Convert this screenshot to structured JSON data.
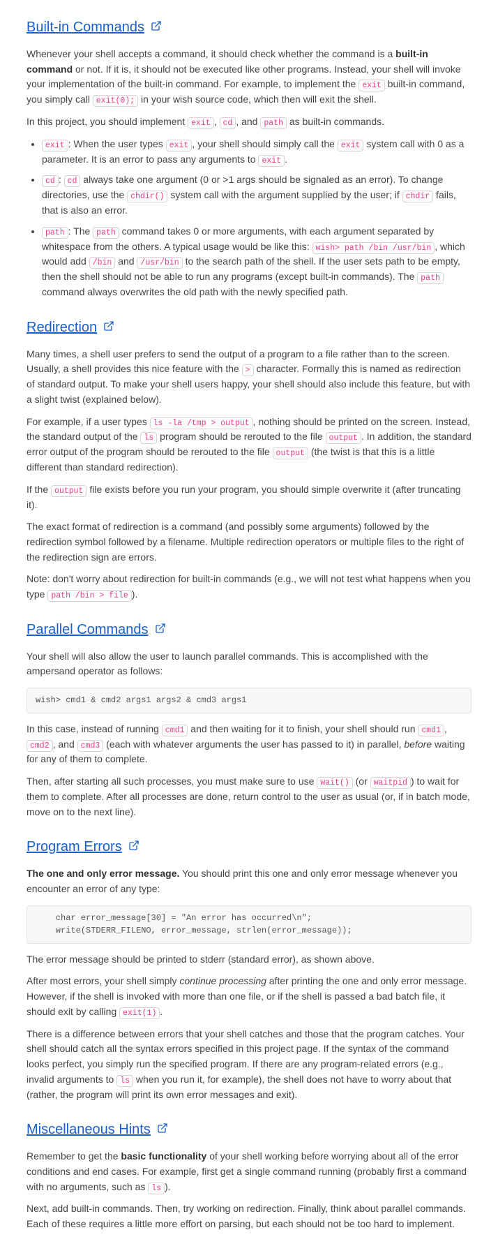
{
  "sections": {
    "builtin": {
      "heading": "Built-in Commands",
      "p1_a": "Whenever your shell accepts a command, it should check whether the command is a ",
      "p1_b": "built-in command",
      "p1_c": " or not. If it is, it should not be executed like other programs. Instead, your shell will invoke your implementation of the built-in command. For example, to implement the ",
      "p1_d": " built-in command, you simply call ",
      "p1_e": " in your wish source code, which then will exit the shell.",
      "p2_a": "In this project, you should implement ",
      "p2_b": ", ",
      "p2_c": ", and ",
      "p2_d": " as built-in commands.",
      "li1_a": ": When the user types ",
      "li1_b": ", your shell should simply call the ",
      "li1_c": " system call with 0 as a parameter. It is an error to pass any arguments to ",
      "li1_d": ".",
      "li2_a": ": ",
      "li2_b": " always take one argument (0 or >1 args should be signaled as an error). To change directories, use the ",
      "li2_c": " system call with the argument supplied by the user; if ",
      "li2_d": " fails, that is also an error.",
      "li3_a": ": The ",
      "li3_b": " command takes 0 or more arguments, with each argument separated by whitespace from the others. A typical usage would be like this: ",
      "li3_c": ", which would add ",
      "li3_d": " and ",
      "li3_e": " to the search path of the shell. If the user sets path to be empty, then the shell should not be able to run any programs (except built-in commands). The ",
      "li3_f": " command always overwrites the old path with the newly specified path."
    },
    "redirection": {
      "heading": "Redirection",
      "p1_a": "Many times, a shell user prefers to send the output of a program to a file rather than to the screen. Usually, a shell provides this nice feature with the ",
      "p1_b": " character. Formally this is named as redirection of standard output. To make your shell users happy, your shell should also include this feature, but with a slight twist (explained below).",
      "p2_a": "For example, if a user types ",
      "p2_b": ", nothing should be printed on the screen. Instead, the standard output of the ",
      "p2_c": " program should be rerouted to the file ",
      "p2_d": ". In addition, the standard error output of the program should be rerouted to the file ",
      "p2_e": " (the twist is that this is a little different than standard redirection).",
      "p3_a": "If the ",
      "p3_b": " file exists before you run your program, you should simple overwrite it (after truncating it).",
      "p4": "The exact format of redirection is a command (and possibly some arguments) followed by the redirection symbol followed by a filename. Multiple redirection operators or multiple files to the right of the redirection sign are errors.",
      "p5_a": "Note: don't worry about redirection for built-in commands (e.g., we will not test what happens when you type ",
      "p5_b": ")."
    },
    "parallel": {
      "heading": "Parallel Commands",
      "p1": "Your shell will also allow the user to launch parallel commands. This is accomplished with the ampersand operator as follows:",
      "code1": "wish> cmd1 & cmd2 args1 args2 & cmd3 args1",
      "p2_a": "In this case, instead of running ",
      "p2_b": " and then waiting for it to finish, your shell should run ",
      "p2_c": ", ",
      "p2_d": ", and ",
      "p2_e": " (each with whatever arguments the user has passed to it) in parallel, ",
      "p2_f": "before",
      "p2_g": " waiting for any of them to complete.",
      "p3_a": "Then, after starting all such processes, you must make sure to use ",
      "p3_b": " (or ",
      "p3_c": ") to wait for them to complete. After all processes are done, return control to the user as usual (or, if in batch mode, move on to the next line)."
    },
    "errors": {
      "heading": "Program Errors",
      "p1_a": "The one and only error message.",
      "p1_b": " You should print this one and only error message whenever you encounter an error of any type:",
      "code1": "    char error_message[30] = \"An error has occurred\\n\";\n    write(STDERR_FILENO, error_message, strlen(error_message));",
      "p2": "The error message should be printed to stderr (standard error), as shown above.",
      "p3_a": "After most errors, your shell simply ",
      "p3_b": "continue processing",
      "p3_c": " after printing the one and only error message. However, if the shell is invoked with more than one file, or if the shell is passed a bad batch file, it should exit by calling ",
      "p3_d": ".",
      "p4_a": "There is a difference between errors that your shell catches and those that the program catches. Your shell should catch all the syntax errors specified in this project page. If the syntax of the command looks perfect, you simply run the specified program. If there are any program-related errors (e.g., invalid arguments to ",
      "p4_b": " when you run it, for example), the shell does not have to worry about that (rather, the program will print its own error messages and exit)."
    },
    "hints": {
      "heading": "Miscellaneous Hints",
      "p1_a": "Remember to get the ",
      "p1_b": "basic functionality",
      "p1_c": " of your shell working before worrying about all of the error conditions and end cases. For example, first get a single command running (probably first a command with no arguments, such as ",
      "p1_d": ").",
      "p2": "Next, add built-in commands. Then, try working on redirection. Finally, think about parallel commands. Each of these requires a little more effort on parsing, but each should not be too hard to implement."
    }
  },
  "codes": {
    "exit": "exit",
    "exit0": "exit(0);",
    "cd": "cd",
    "path": "path",
    "chdirfn": "chdir()",
    "chdir": "chdir",
    "wishpath": "wish> path /bin /usr/bin",
    "bin": "/bin",
    "usrbin": "/usr/bin",
    "gt": ">",
    "lsla": "ls -la /tmp > output",
    "ls": "ls",
    "output": "output",
    "pathfile": "path /bin > file",
    "cmd1": "cmd1",
    "cmd2": "cmd2",
    "cmd3": "cmd3",
    "waitfn": "wait()",
    "waitpid": "waitpid",
    "exit1": "exit(1)"
  }
}
